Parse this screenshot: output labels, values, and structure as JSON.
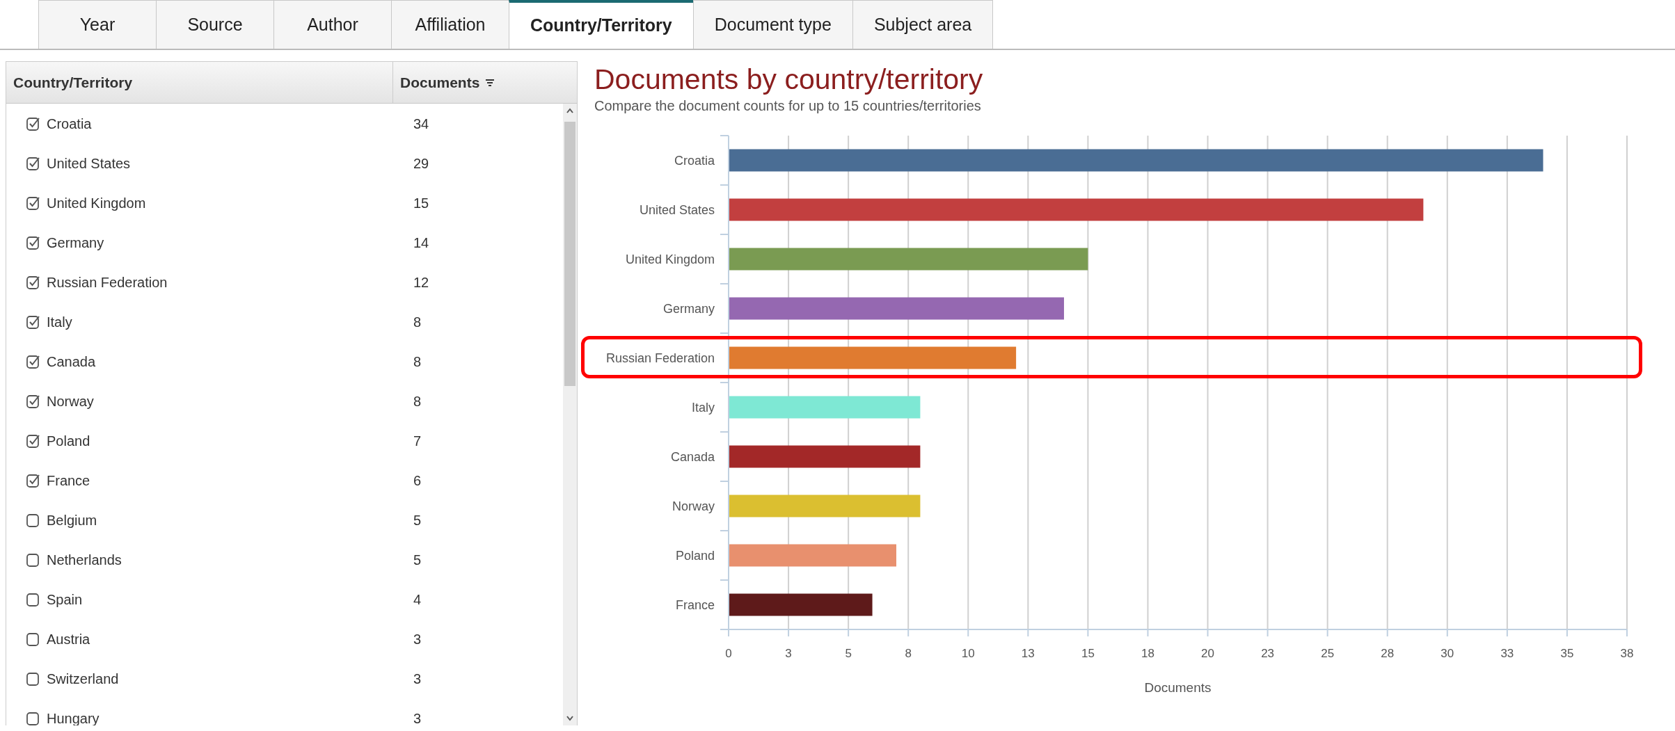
{
  "tabs": [
    {
      "label": "Year",
      "selected": false
    },
    {
      "label": "Source",
      "selected": false
    },
    {
      "label": "Author",
      "selected": false
    },
    {
      "label": "Affiliation",
      "selected": false
    },
    {
      "label": "Country/Territory",
      "selected": true
    },
    {
      "label": "Document type",
      "selected": false
    },
    {
      "label": "Subject area",
      "selected": false
    }
  ],
  "table": {
    "columns": [
      "Country/Territory",
      "Documents"
    ],
    "rows": [
      {
        "name": "Croatia",
        "count": "34",
        "checked": true
      },
      {
        "name": "United States",
        "count": "29",
        "checked": true
      },
      {
        "name": "United Kingdom",
        "count": "15",
        "checked": true
      },
      {
        "name": "Germany",
        "count": "14",
        "checked": true
      },
      {
        "name": "Russian Federation",
        "count": "12",
        "checked": true
      },
      {
        "name": "Italy",
        "count": "8",
        "checked": true
      },
      {
        "name": "Canada",
        "count": "8",
        "checked": true
      },
      {
        "name": "Norway",
        "count": "8",
        "checked": true
      },
      {
        "name": "Poland",
        "count": "7",
        "checked": true
      },
      {
        "name": "France",
        "count": "6",
        "checked": true
      },
      {
        "name": "Belgium",
        "count": "5",
        "checked": false
      },
      {
        "name": "Netherlands",
        "count": "5",
        "checked": false
      },
      {
        "name": "Spain",
        "count": "4",
        "checked": false
      },
      {
        "name": "Austria",
        "count": "3",
        "checked": false
      },
      {
        "name": "Switzerland",
        "count": "3",
        "checked": false
      },
      {
        "name": "Hungary",
        "count": "3",
        "checked": false
      }
    ]
  },
  "chart": {
    "title": "Documents by country/territory",
    "subtitle": "Compare the document counts for up to 15 countries/territories",
    "chart_data": {
      "type": "bar",
      "orientation": "horizontal",
      "xlabel": "Documents",
      "categories": [
        "Croatia",
        "United States",
        "United Kingdom",
        "Germany",
        "Russian Federation",
        "Italy",
        "Canada",
        "Norway",
        "Poland",
        "France"
      ],
      "values": [
        34,
        29,
        15,
        14,
        12,
        8,
        8,
        8,
        7,
        6
      ],
      "colors": [
        "#4a6d94",
        "#c23f3f",
        "#7a9b52",
        "#9568b1",
        "#e07b30",
        "#7ee8d4",
        "#a32828",
        "#dbbf30",
        "#e8906e",
        "#5e1a1a"
      ],
      "xlim": [
        0,
        37.5
      ],
      "xticks": [
        0,
        {
          "value": 2.5,
          "label": "3"
        },
        5,
        {
          "value": 7.5,
          "label": "8"
        },
        10,
        {
          "value": 12.5,
          "label": "13"
        },
        15,
        {
          "value": 17.5,
          "label": "18"
        },
        20,
        {
          "value": 22.5,
          "label": "23"
        },
        25,
        {
          "value": 27.5,
          "label": "28"
        },
        30,
        {
          "value": 32.5,
          "label": "33"
        },
        35,
        {
          "value": 37.5,
          "label": "38"
        }
      ],
      "grid": true
    },
    "highlighted_bars": [
      false,
      false,
      false,
      false,
      true,
      false,
      false,
      false,
      false,
      false
    ]
  }
}
